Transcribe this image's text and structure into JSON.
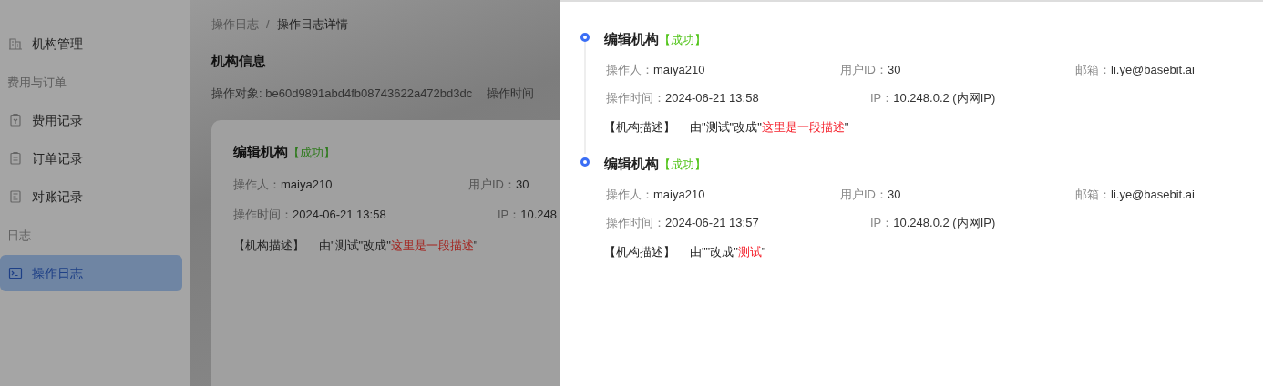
{
  "sidebar": {
    "items": [
      {
        "kind": "item",
        "label": "机构管理",
        "selected": false
      },
      {
        "kind": "header",
        "label": "费用与订单"
      },
      {
        "kind": "item",
        "label": "费用记录",
        "selected": false
      },
      {
        "kind": "item",
        "label": "订单记录",
        "selected": false
      },
      {
        "kind": "item",
        "label": "对账记录",
        "selected": false
      },
      {
        "kind": "header",
        "label": "日志"
      },
      {
        "kind": "item",
        "label": "操作日志",
        "selected": true
      }
    ]
  },
  "breadcrumb": [
    "操作日志",
    "操作日志详情"
  ],
  "separator": "/",
  "page": {
    "title": "机构信息",
    "meta": [
      {
        "label": "操作对象:",
        "value": "be60d9891abd4fb08743622a472bd3dc"
      },
      {
        "label": "操作时间"
      }
    ],
    "card": {
      "title": "编辑机构",
      "status": "【成功】",
      "operator_label": "操作人：",
      "operator": "maiya210",
      "user_id_label": "用户ID：",
      "user_id": "30",
      "time_label": "操作时间：",
      "time": "2024-06-21 13:58",
      "ip_label": "IP：",
      "ip": "10.248",
      "field": "【机构描述】",
      "change_before": "由\"测试\"改成\"",
      "change_new": "这里是一段描述",
      "change_after": "\""
    }
  },
  "drawer": {
    "entries": [
      {
        "title": "编辑机构",
        "status": "【成功】",
        "operator_label": "操作人：",
        "operator": "maiya210",
        "user_id_label": "用户ID：",
        "user_id": "30",
        "email_label": "邮箱：",
        "email": "li.ye@basebit.ai",
        "time_label": "操作时间：",
        "time": "2024-06-21 13:58",
        "ip_label": "IP：",
        "ip": "10.248.0.2 (内网IP)",
        "field": "【机构描述】",
        "change_before": "由\"测试\"改成\"",
        "change_new": "这里是一段描述",
        "change_after": "\""
      },
      {
        "title": "编辑机构",
        "status": "【成功】",
        "operator_label": "操作人：",
        "operator": "maiya210",
        "user_id_label": "用户ID：",
        "user_id": "30",
        "email_label": "邮箱：",
        "email": "li.ye@basebit.ai",
        "time_label": "操作时间：",
        "time": "2024-06-21 13:57",
        "ip_label": "IP：",
        "ip": "10.248.0.2 (内网IP)",
        "field": "【机构描述】",
        "change_before": "由\"\"改成\"",
        "change_new": "测试",
        "change_after": "\""
      }
    ]
  }
}
